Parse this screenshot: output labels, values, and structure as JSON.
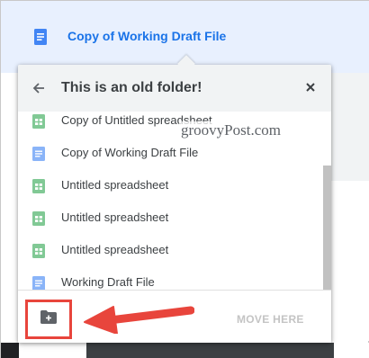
{
  "selected_file": {
    "name": "Copy of Working Draft File",
    "icon": "google-docs-icon"
  },
  "dialog": {
    "title": "This is an old folder!",
    "back_icon": "arrow-left-icon",
    "close_icon": "close-icon",
    "items": [
      {
        "label": "Copy of Untitled spreadsheet",
        "icon": "google-sheets-icon"
      },
      {
        "label": "Copy of Working Draft File",
        "icon": "google-docs-icon"
      },
      {
        "label": "Untitled spreadsheet",
        "icon": "google-sheets-icon"
      },
      {
        "label": "Untitled spreadsheet",
        "icon": "google-sheets-icon"
      },
      {
        "label": "Untitled spreadsheet",
        "icon": "google-sheets-icon"
      },
      {
        "label": "Working Draft File",
        "icon": "google-docs-icon"
      }
    ],
    "footer": {
      "new_folder_icon": "new-folder-icon",
      "move_here_label": "MOVE HERE"
    }
  },
  "watermark": "groovyPost.com",
  "colors": {
    "accent": "#1a73e8",
    "header_bg": "#e8f0fe",
    "highlight_red": "#e8453c",
    "docs_blue": "#8ab4f8",
    "sheets_green": "#81c995"
  }
}
